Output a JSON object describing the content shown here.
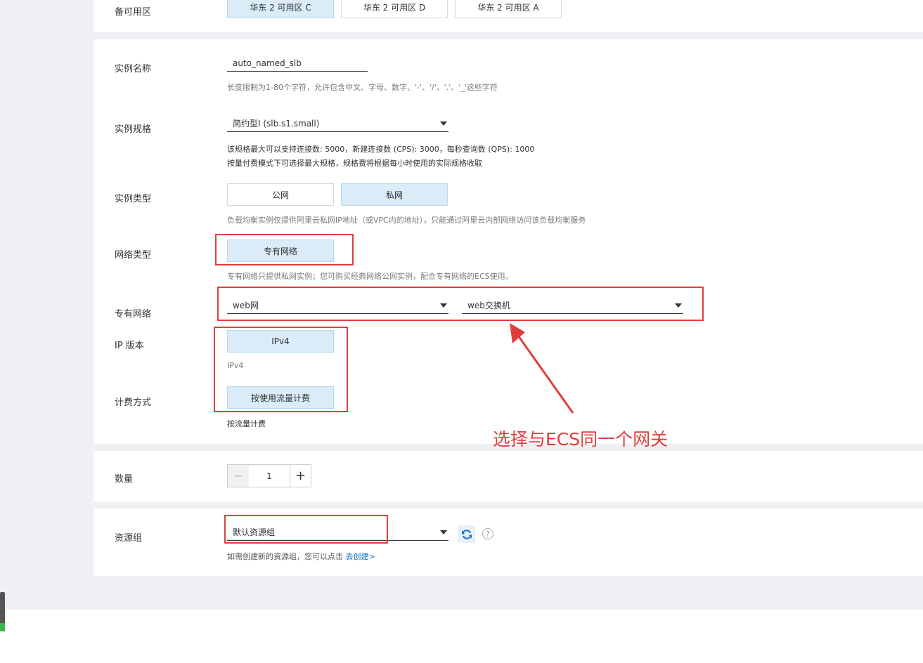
{
  "zone": {
    "label": "备可用区",
    "options": [
      "华东 2 可用区 C",
      "华东 2 可用区 D",
      "华东 2 可用区 A"
    ],
    "selected_index": 0
  },
  "instance_name": {
    "label": "实例名称",
    "value": "auto_named_slb",
    "hint": "长度限制为1-80个字符，允许包含中文、字母、数字、'-'、'/'、'.'、'_'这些字符"
  },
  "instance_spec": {
    "label": "实例规格",
    "value": "简约型I (slb.s1.small)",
    "hint_line1": "该规格最大可以支持连接数: 5000，新建连接数 (CPS): 3000，每秒查询数 (QPS): 1000",
    "hint_line2": "按量付费模式下可选择最大规格，规格费将根据每小时使用的实际规格收取"
  },
  "instance_type": {
    "label": "实例类型",
    "options": [
      "公网",
      "私网"
    ],
    "selected_index": 1,
    "hint": "负载均衡实例仅提供阿里云私网IP地址（或VPC内的地址），只能通过阿里云内部网络访问该负载均衡服务"
  },
  "network_type": {
    "label": "网络类型",
    "option": "专有网络",
    "hint": "专有网络只提供私网实例；您可购买经典网络公网实例，配合专有网络的ECS使用。"
  },
  "vpc": {
    "label": "专有网络",
    "vpc_value": "web网",
    "vswitch_value": "web交换机"
  },
  "ip_version": {
    "label": "IP 版本",
    "option": "IPv4",
    "hint": "IPv4"
  },
  "billing": {
    "label": "计费方式",
    "option": "按使用流量计费",
    "hint": "按流量计费"
  },
  "quantity": {
    "label": "数量",
    "minus": "−",
    "value": "1",
    "plus": "+"
  },
  "resource_group": {
    "label": "资源组",
    "value": "默认资源组",
    "help": "?",
    "hint_prefix": "如需创建新的资源组，您可以点击",
    "hint_link": "去创建>"
  },
  "annotation": {
    "text": "选择与ECS同一个网关"
  },
  "colors": {
    "selected_bg": "#d9ecf7",
    "annotation_red": "#e23d3d",
    "link_blue": "#0070cc"
  }
}
